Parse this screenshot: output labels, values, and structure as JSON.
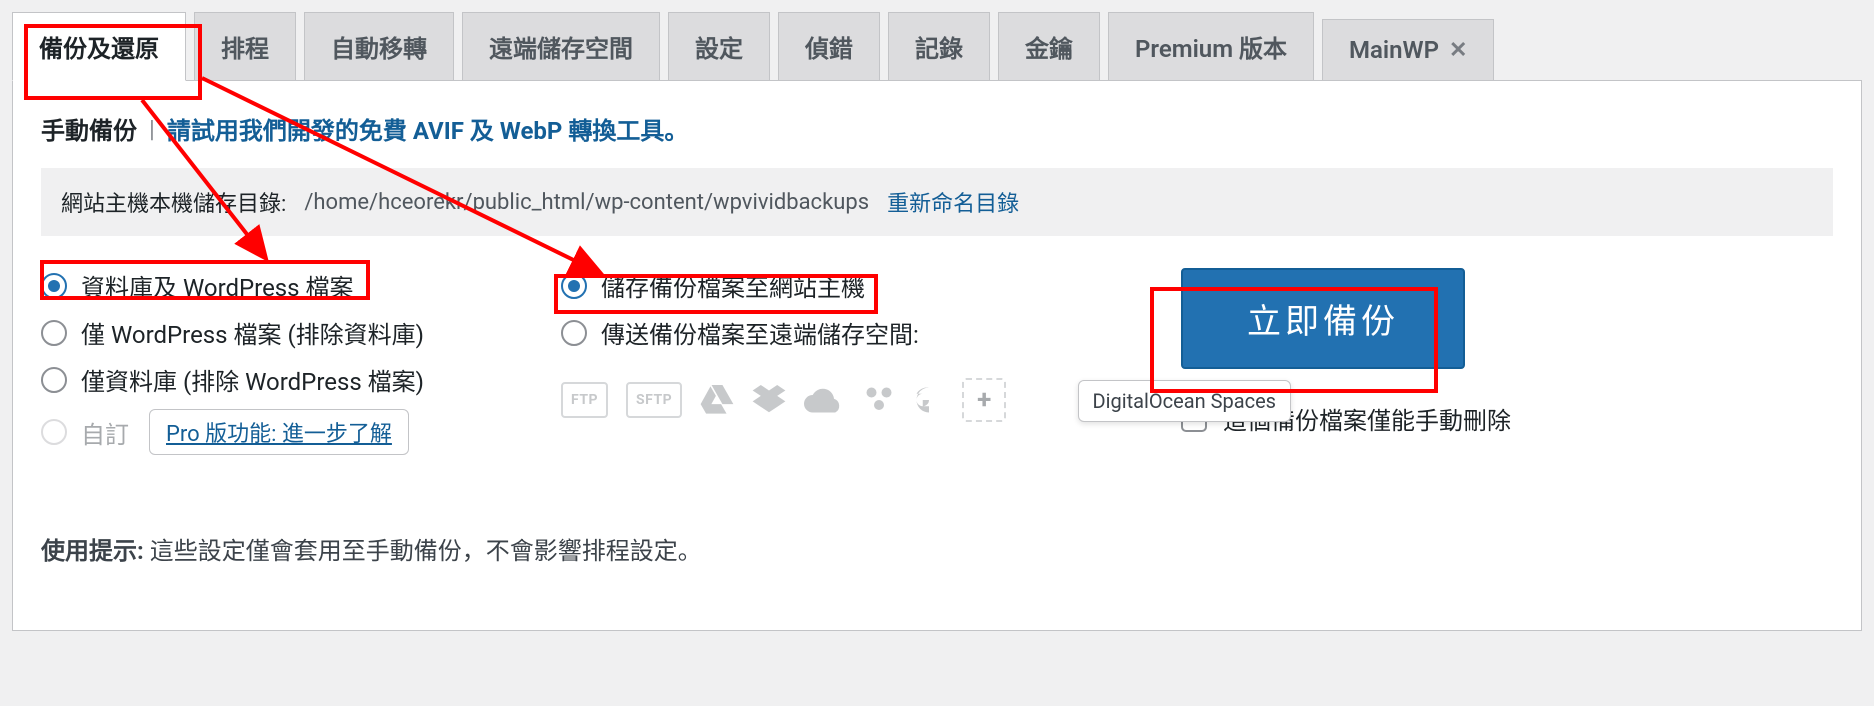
{
  "tabs": [
    {
      "label": "備份及還原",
      "active": true
    },
    {
      "label": "排程"
    },
    {
      "label": "自動移轉"
    },
    {
      "label": "遠端儲存空間"
    },
    {
      "label": "設定"
    },
    {
      "label": "偵錯"
    },
    {
      "label": "記錄"
    },
    {
      "label": "金鑰"
    },
    {
      "label": "Premium 版本"
    },
    {
      "label": "MainWP",
      "closable": true
    }
  ],
  "header": {
    "title": "手動備份",
    "sep": "|",
    "promo": "請試用我們開發的免費 AVIF 及 WebP 轉換工具。"
  },
  "storage_path": {
    "label": "網站主機本機儲存目錄:",
    "path": "/home/hceorekr/public_html/wp-content/wpvividbackups",
    "rename": "重新命名目錄"
  },
  "what_to_backup": [
    {
      "label": "資料庫及 WordPress 檔案",
      "checked": true
    },
    {
      "label": "僅 WordPress 檔案 (排除資料庫)",
      "checked": false
    },
    {
      "label": "僅資料庫 (排除 WordPress 檔案)",
      "checked": false
    }
  ],
  "custom_row": {
    "label": "自訂",
    "pro_link": "Pro 版功能: 進一步了解"
  },
  "where_to_backup": [
    {
      "label": "儲存備份檔案至網站主機",
      "checked": true
    },
    {
      "label": "傳送備份檔案至遠端儲存空間:",
      "checked": false
    }
  ],
  "storage_icons": {
    "ftp": "FTP",
    "sftp": "SFTP",
    "tooltip": "DigitalOcean Spaces"
  },
  "action": {
    "button": "立即備份",
    "lock_label": "這個備份檔案僅能手動刪除"
  },
  "hint": {
    "prefix": "使用提示:",
    "text": " 這些設定僅會套用至手動備份，不會影響排程設定。"
  }
}
